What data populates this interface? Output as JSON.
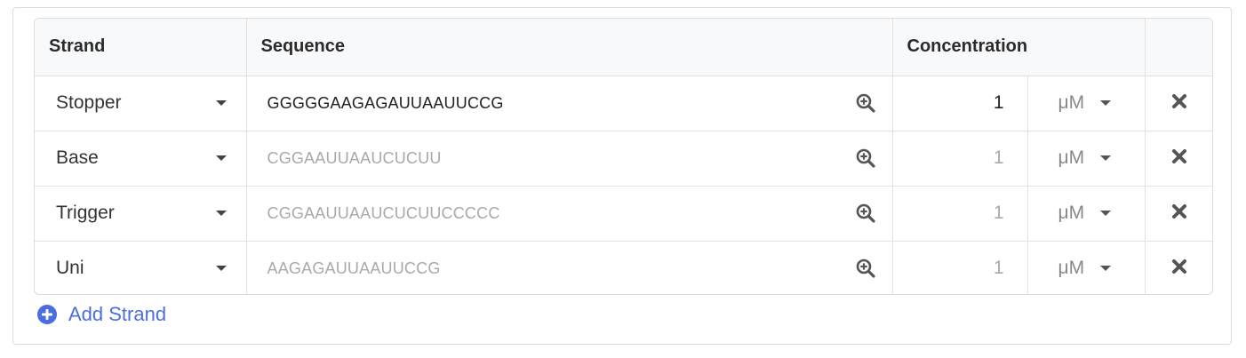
{
  "table": {
    "headers": {
      "strand": "Strand",
      "sequence": "Sequence",
      "concentration": "Concentration",
      "actions": ""
    },
    "rows": [
      {
        "strand": "Stopper",
        "sequence": "GGGGGAAGAGAUUAAUUCCG",
        "sequence_state": "filled",
        "concentration": "1",
        "concentration_state": "filled",
        "unit": "μM"
      },
      {
        "strand": "Base",
        "sequence": "CGGAAUUAAUCUCUU",
        "sequence_state": "placeholder",
        "concentration": "1",
        "concentration_state": "placeholder",
        "unit": "μM"
      },
      {
        "strand": "Trigger",
        "sequence": "CGGAAUUAAUCUCUUCCCCC",
        "sequence_state": "placeholder",
        "concentration": "1",
        "concentration_state": "placeholder",
        "unit": "μM"
      },
      {
        "strand": "Uni",
        "sequence": "AAGAGAUUAAUUCCG",
        "sequence_state": "placeholder",
        "concentration": "1",
        "concentration_state": "placeholder",
        "unit": "μM"
      }
    ]
  },
  "add_strand_label": "Add Strand",
  "icons": {
    "dropdown": "caret-down-icon",
    "zoom": "zoom-in-icon",
    "delete": "close-icon",
    "add": "plus-circle-icon"
  },
  "colors": {
    "accent": "#4a6ee0",
    "placeholder_text": "#a9a9a9",
    "header_bg": "#f8f9fb",
    "border": "#e2e2e2"
  }
}
